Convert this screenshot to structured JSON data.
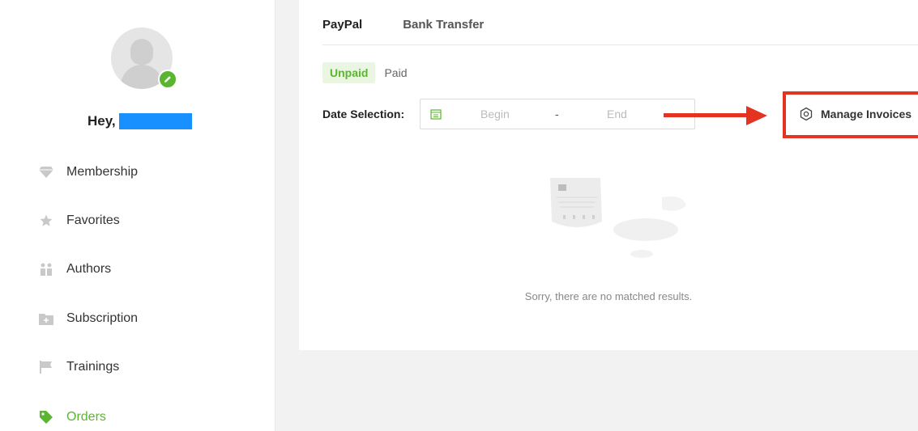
{
  "sidebar": {
    "greeting": "Hey,",
    "items": [
      {
        "label": "Membership",
        "icon": "diamond-icon"
      },
      {
        "label": "Favorites",
        "icon": "star-icon"
      },
      {
        "label": "Authors",
        "icon": "people-icon"
      },
      {
        "label": "Subscription",
        "icon": "folder-plus-icon"
      },
      {
        "label": "Trainings",
        "icon": "flag-icon"
      },
      {
        "label": "Orders",
        "icon": "tag-icon",
        "active": true
      }
    ]
  },
  "payment_tabs": {
    "paypal": "PayPal",
    "bank": "Bank Transfer"
  },
  "status_tabs": {
    "unpaid": "Unpaid",
    "paid": "Paid"
  },
  "date_selection": {
    "label": "Date Selection:",
    "begin_placeholder": "Begin",
    "separator": "-",
    "end_placeholder": "End"
  },
  "manage_invoices": "Manage Invoices",
  "empty_message": "Sorry, there are no matched results.",
  "colors": {
    "accent_green": "#5cb531",
    "annotation_red": "#e53321",
    "redaction_blue": "#1890ff"
  }
}
